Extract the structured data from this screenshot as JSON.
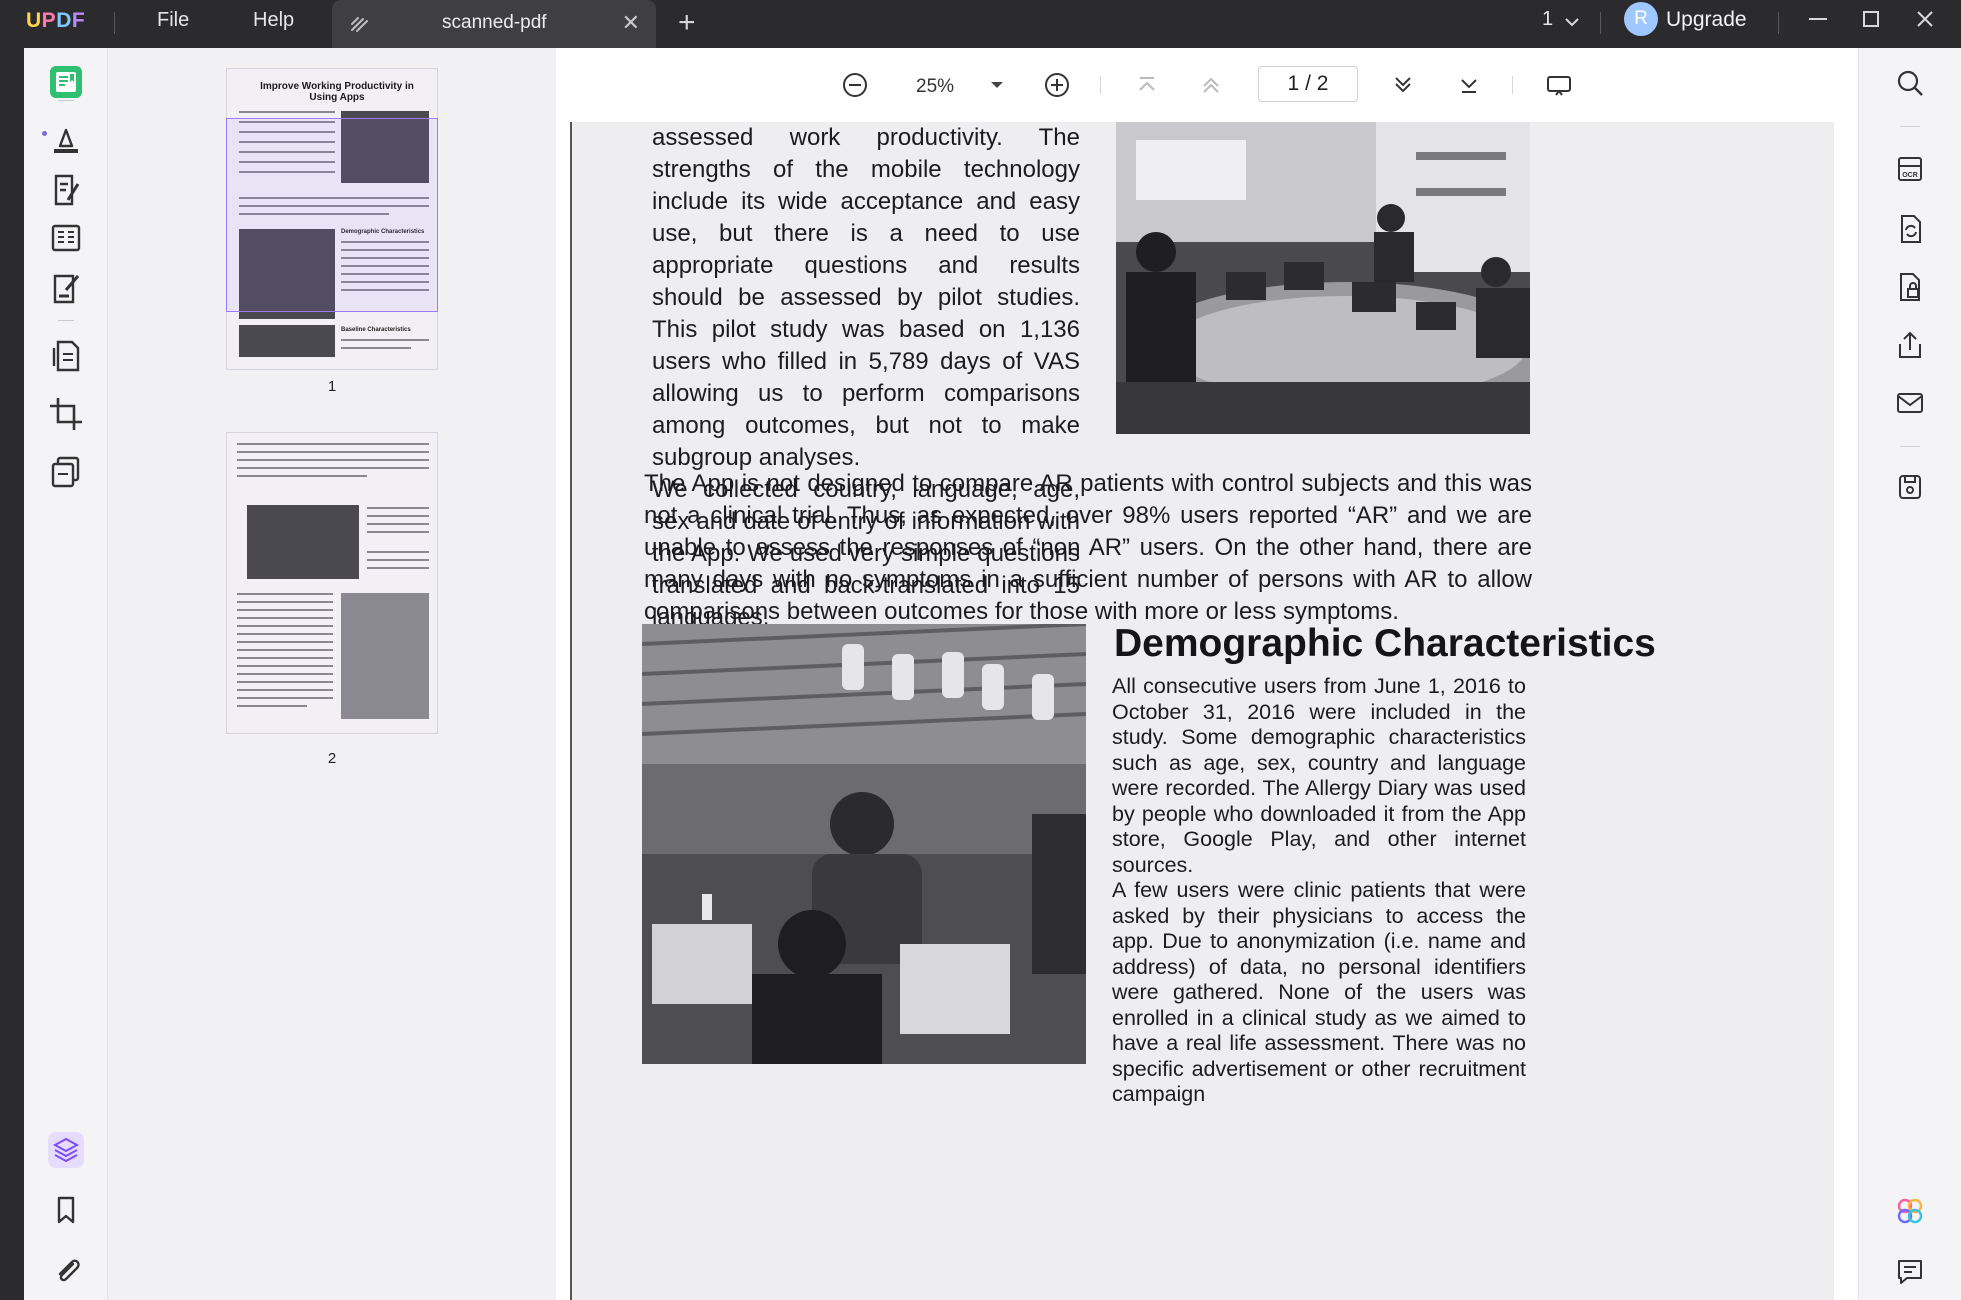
{
  "app": {
    "logo": "UPDF",
    "menu": {
      "file": "File",
      "help": "Help"
    },
    "tab": {
      "title": "scanned-pdf"
    },
    "window_count": "1",
    "user_initial": "R",
    "upgrade_label": "Upgrade"
  },
  "toolbar": {
    "zoom": "25%",
    "current_page": "1",
    "page_separator": "/",
    "total_pages": "2"
  },
  "thumbnails": [
    {
      "number": "1",
      "title": "Improve Working Productivity in Using Apps",
      "headings": [
        "Demographic Characteristics",
        "Baseline Characteristics"
      ]
    },
    {
      "number": "2"
    }
  ],
  "document": {
    "col1_paragraphs": [
      "assessed work productivity. The strengths of the mobile technology include its wide acceptance and easy use, but there is a need to use appropriate questions and results should be assessed by pilot studies. This pilot study was based on 1,136 users who filled in 5,789 days of VAS allowing us to perform comparisons among outcomes, but not to make subgroup analyses.",
      "We collected country, language, age, sex and date of entry of information with the App. We used very simple questions translated and back-translated into 15 languages."
    ],
    "middle_paragraph": "The App is not designed to compare AR patients with control subjects and this was not a clinical trial. Thus, as expected, over 98% users reported “AR” and we are unable to assess the responses of “non AR” users. On the other hand, there are many days with no symptoms in a sufficient number of persons with AR to allow comparisons between outcomes for those with more or less symptoms.",
    "section_heading": "Demographic Characteristics",
    "section_paragraphs": [
      "All consecutive users from June 1, 2016 to October 31, 2016 were included in the study. Some demographic characteristics such as age, sex, country and language were recorded. The Allergy Diary was used by people who downloaded it from the App store, Google Play, and other internet sources.",
      "A few users were clinic patients that were asked by their physicians to access the app. Due to anonymization (i.e. name and address) of data, no personal identifiers were gathered. None of the users was enrolled in a clinical study as we aimed to have a real life assessment. There was no specific advertisement or other recruitment campaign"
    ]
  }
}
